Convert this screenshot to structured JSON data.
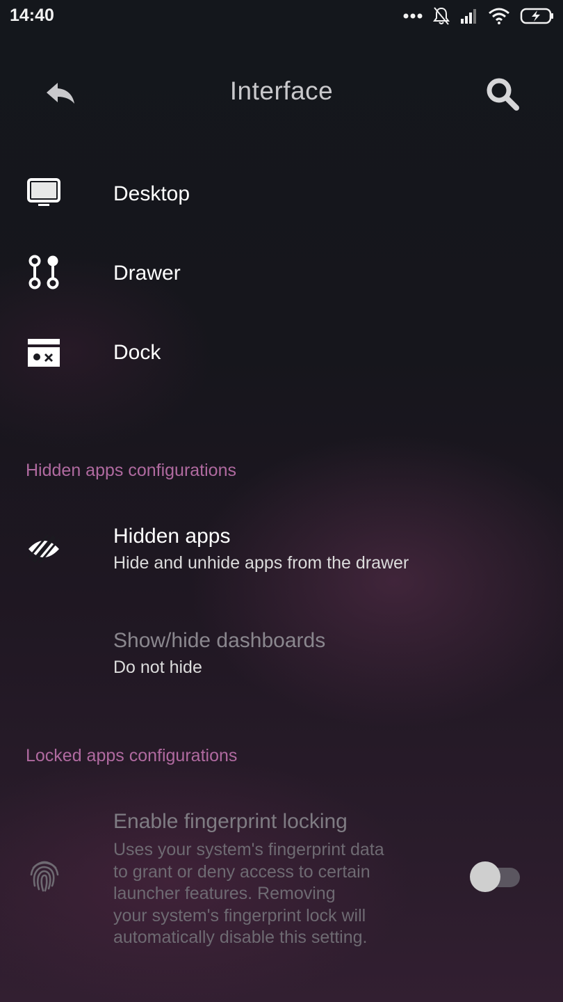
{
  "status_bar": {
    "time": "14:40",
    "icons": [
      "more-dots-icon",
      "bell-off-icon",
      "signal-icon",
      "wifi-icon",
      "battery-charging-icon"
    ]
  },
  "app_bar": {
    "title": "Interface",
    "back_icon": "back-arrow-icon",
    "search_icon": "search-icon"
  },
  "menu": [
    {
      "label": "Desktop",
      "icon": "monitor-icon"
    },
    {
      "label": "Drawer",
      "icon": "drawer-icon"
    },
    {
      "label": "Dock",
      "icon": "dock-icon"
    }
  ],
  "sections": {
    "hidden": {
      "header": "Hidden apps configurations",
      "hidden_apps": {
        "title": "Hidden apps",
        "summary": "Hide and unhide apps from the drawer",
        "icon": "eye-off-icon"
      },
      "dashboards": {
        "title": "Show/hide dashboards",
        "summary": "Do not hide"
      }
    },
    "locked": {
      "header": "Locked apps configurations",
      "fingerprint": {
        "title": "Enable fingerprint locking",
        "summary_lines": [
          "Uses your system's fingerprint data",
          "to grant or deny access to certain",
          "launcher features. Removing",
          "your system's fingerprint lock will",
          "automatically disable this setting."
        ],
        "icon": "fingerprint-icon",
        "enabled": false
      }
    }
  },
  "colors": {
    "accent": "#b06aa0",
    "text_primary": "#ffffff",
    "text_disabled": "#7f7c83"
  }
}
